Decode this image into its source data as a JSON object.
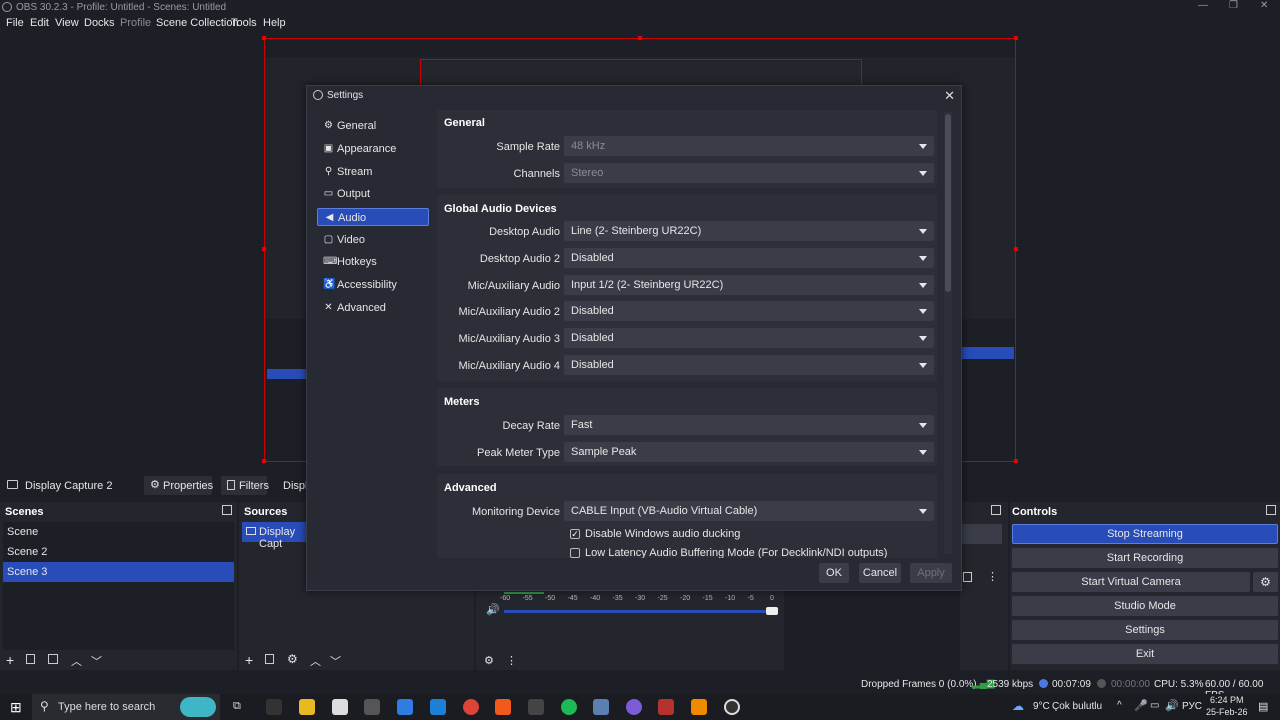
{
  "window": {
    "title": "OBS 30.2.3 - Profile: Untitled - Scenes: Untitled"
  },
  "menu": [
    "File",
    "Edit",
    "View",
    "Docks",
    "Profile",
    "Scene Collection",
    "Tools",
    "Help"
  ],
  "source_toolbar": {
    "source_name": "Display Capture 2",
    "properties_label": "Properties",
    "filters_label": "Filters",
    "display_label": "Displa"
  },
  "scenes": {
    "title": "Scenes",
    "items": [
      "Scene",
      "Scene 2",
      "Scene 3"
    ],
    "selected": "Scene 3"
  },
  "sources": {
    "title": "Sources",
    "items": [
      "Display Capt"
    ]
  },
  "mixer": {
    "ticks": [
      "-60",
      "-55",
      "-50",
      "-45",
      "-40",
      "-35",
      "-30",
      "-25",
      "-20",
      "-15",
      "-10",
      "-5",
      "0"
    ]
  },
  "controls": {
    "title": "Controls",
    "stop_streaming": "Stop Streaming",
    "start_recording": "Start Recording",
    "start_virtual_camera": "Start Virtual Camera",
    "studio_mode": "Studio Mode",
    "settings": "Settings",
    "exit": "Exit"
  },
  "settings_dialog": {
    "title": "Settings",
    "nav": [
      {
        "label": "General",
        "icon": "gear-icon"
      },
      {
        "label": "Appearance",
        "icon": "appearance-icon"
      },
      {
        "label": "Stream",
        "icon": "antenna-icon"
      },
      {
        "label": "Output",
        "icon": "output-icon"
      },
      {
        "label": "Audio",
        "icon": "speaker-icon"
      },
      {
        "label": "Video",
        "icon": "monitor-icon"
      },
      {
        "label": "Hotkeys",
        "icon": "keyboard-icon"
      },
      {
        "label": "Accessibility",
        "icon": "accessibility-icon"
      },
      {
        "label": "Advanced",
        "icon": "tools-icon"
      }
    ],
    "selected_nav": "Audio",
    "general": {
      "title": "General",
      "sample_rate_label": "Sample Rate",
      "sample_rate_value": "48 kHz",
      "channels_label": "Channels",
      "channels_value": "Stereo"
    },
    "global_audio": {
      "title": "Global Audio Devices",
      "rows": [
        {
          "label": "Desktop Audio",
          "value": "Line (2- Steinberg UR22C)"
        },
        {
          "label": "Desktop Audio 2",
          "value": "Disabled"
        },
        {
          "label": "Mic/Auxiliary Audio",
          "value": "Input 1/2 (2- Steinberg UR22C)"
        },
        {
          "label": "Mic/Auxiliary Audio 2",
          "value": "Disabled"
        },
        {
          "label": "Mic/Auxiliary Audio 3",
          "value": "Disabled"
        },
        {
          "label": "Mic/Auxiliary Audio 4",
          "value": "Disabled"
        }
      ]
    },
    "meters": {
      "title": "Meters",
      "decay_rate_label": "Decay Rate",
      "decay_rate_value": "Fast",
      "peak_meter_label": "Peak Meter Type",
      "peak_meter_value": "Sample Peak"
    },
    "advanced": {
      "title": "Advanced",
      "monitoring_label": "Monitoring Device",
      "monitoring_value": "CABLE Input (VB-Audio Virtual Cable)",
      "ducking_label": "Disable Windows audio ducking",
      "ducking_checked": true,
      "low_latency_label": "Low Latency Audio Buffering Mode (For Decklink/NDI outputs)",
      "low_latency_checked": false
    },
    "buttons": {
      "ok": "OK",
      "cancel": "Cancel",
      "apply": "Apply"
    }
  },
  "status_bar": {
    "dropped_frames": "Dropped Frames 0 (0.0%)",
    "bitrate": "2539 kbps",
    "stream_time": "00:07:09",
    "record_time": "00:00:00",
    "cpu": "CPU: 5.3%",
    "fps": "60.00 / 60.00 FPS"
  },
  "taskbar": {
    "search_placeholder": "Type here to search",
    "weather": "9°C",
    "weather_desc": "Çok bulutlu",
    "language": "РУС",
    "time": "6:24 PM",
    "date": "25-Feb-26"
  },
  "colors": {
    "accent": "#284cb8",
    "preview_border": "#cc0000",
    "background": "#1d1f26"
  }
}
